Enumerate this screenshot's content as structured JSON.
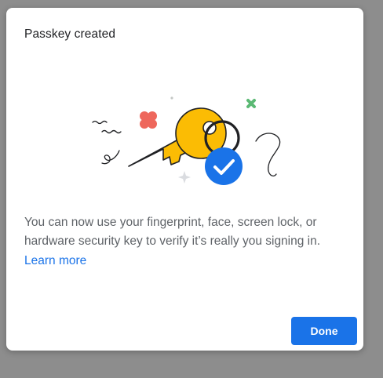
{
  "dialog": {
    "title": "Passkey created",
    "message": "You can now use your fingerprint, face, screen lock, or hardware security key to verify it’s really you signing in.",
    "learn_more_label": "Learn more",
    "done_label": "Done"
  },
  "illustration": {
    "icons": [
      "key-icon",
      "checkmark-badge-icon",
      "sparkle-icon",
      "squiggle-icon",
      "cross-icon",
      "flower-icon"
    ]
  },
  "colors": {
    "accent": "#1a73e8",
    "key": "#fbbc04",
    "key_outline": "#202124",
    "badge": "#1a73e8",
    "cross": "#5bb974",
    "flower": "#ee675c",
    "overlay": "#8d8d8d"
  }
}
